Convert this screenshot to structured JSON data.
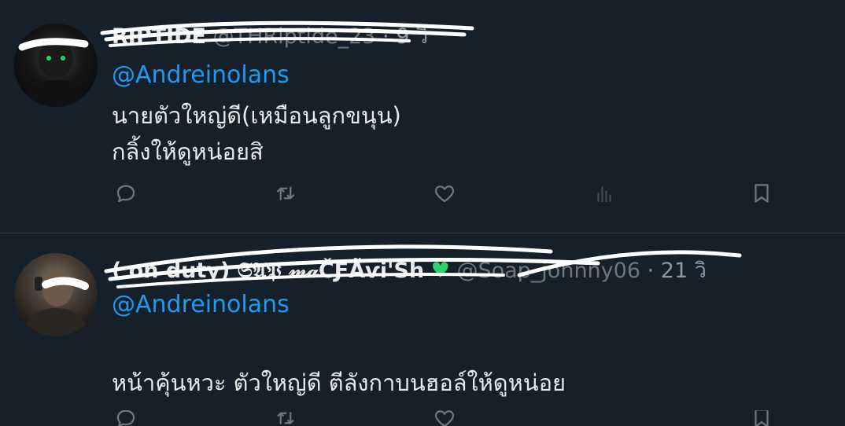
{
  "tweets": [
    {
      "name": "RIPTIDE",
      "handle": "@THRiptide_23",
      "time": "9 วิ",
      "mention": "@Andreinolans",
      "lines": [
        "นายตัวใหญ่ดี(เหมือนลูกขนุน)",
        " กลิ้งให้ดูหน่อยสิ"
      ]
    },
    {
      "name": "( on duty) 𝔖𝔄𝔓 𝓂𝒶ČƑÃѵi'Sh",
      "handle": "@Soap_johnny06",
      "time": "21 วิ",
      "mention": "@Andreinolans",
      "lines": [
        "หน้าคุ้นหวะ ตัวใหญ่ดี ตีลังกาบนฮอล์ให้ดูหน่อย"
      ]
    }
  ],
  "colors": {
    "background": "#15202b",
    "text": "#e7e9ea",
    "mention": "#1d9bf0",
    "muted": "#71767b",
    "divider": "#38444d"
  },
  "icons": [
    "reply-icon",
    "retweet-icon",
    "like-icon",
    "views-icon",
    "bookmark-icon"
  ]
}
